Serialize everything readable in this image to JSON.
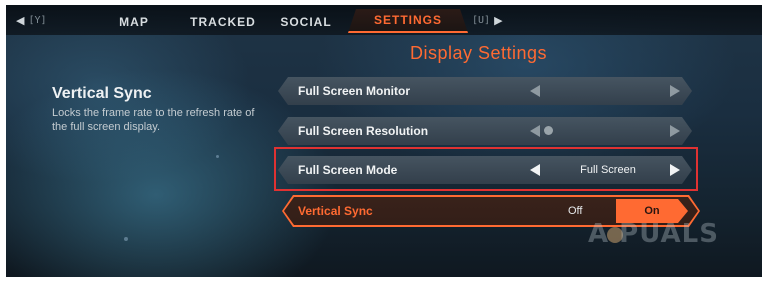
{
  "topbar": {
    "left_hint_key": "[Y]",
    "right_hint_key": "[U]",
    "tabs": [
      {
        "label": "MAP"
      },
      {
        "label": "TRACKED"
      },
      {
        "label": "SOCIAL"
      },
      {
        "label": "SETTINGS",
        "active": true
      }
    ]
  },
  "section_title": "Display Settings",
  "description": {
    "title": "Vertical Sync",
    "text": "Locks the frame rate to the refresh rate of the full screen display."
  },
  "rows": [
    {
      "label": "Full Screen Monitor",
      "value": ""
    },
    {
      "label": "Full Screen Resolution",
      "value": ""
    },
    {
      "label": "Full Screen Mode",
      "value": "Full Screen"
    }
  ],
  "vsync": {
    "label": "Vertical Sync",
    "off_label": "Off",
    "on_label": "On",
    "selected": "On"
  },
  "watermark": "A PUALS",
  "colors": {
    "accent": "#ff6a32",
    "highlight_box": "#e03232"
  }
}
